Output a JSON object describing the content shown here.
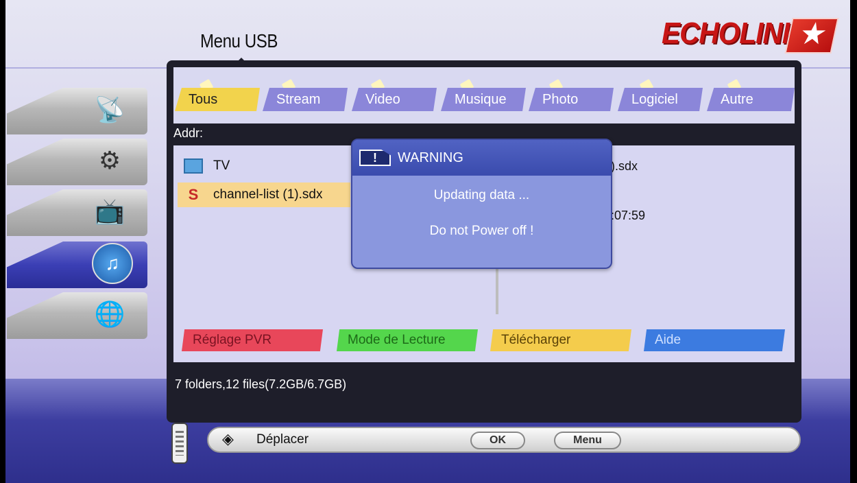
{
  "header": {
    "title": "Menu USB",
    "logo": "ECHOLINK"
  },
  "sidebar": {
    "items": [
      {
        "icon": "satellite-dish-icon"
      },
      {
        "icon": "gears-icon"
      },
      {
        "icon": "tv-icon"
      },
      {
        "icon": "usb-icon",
        "active": true
      },
      {
        "icon": "globe-icon"
      }
    ]
  },
  "tabs": [
    "Tous",
    "Stream",
    "Video",
    "Musique",
    "Photo",
    "Logiciel",
    "Autre"
  ],
  "active_tab": "Tous",
  "addr_label": "Addr:",
  "files": [
    {
      "name": "TV",
      "icon": "tv-folder-icon"
    },
    {
      "name": "channel-list (1).sdx",
      "icon": "sdx-file-icon",
      "selected": true
    }
  ],
  "side_info": {
    "filename_fragment": ").sdx",
    "time_fragment": ":07:59"
  },
  "buttons": [
    {
      "label": "Réglage PVR",
      "color": "#e8475a"
    },
    {
      "label": "Mode de Lecture",
      "color": "#54d64c"
    },
    {
      "label": "Télécharger",
      "color": "#f4cc4c"
    },
    {
      "label": "Aide",
      "color": "#3c7be0"
    }
  ],
  "status": "7 folders,12 files(7.2GB/6.7GB)",
  "dialog": {
    "title": "WARNING",
    "line1": "Updating data ...",
    "line2": "Do not Power off !"
  },
  "control_bar": {
    "move_label": "Déplacer",
    "ok_label": "OK",
    "menu_label": "Menu"
  }
}
